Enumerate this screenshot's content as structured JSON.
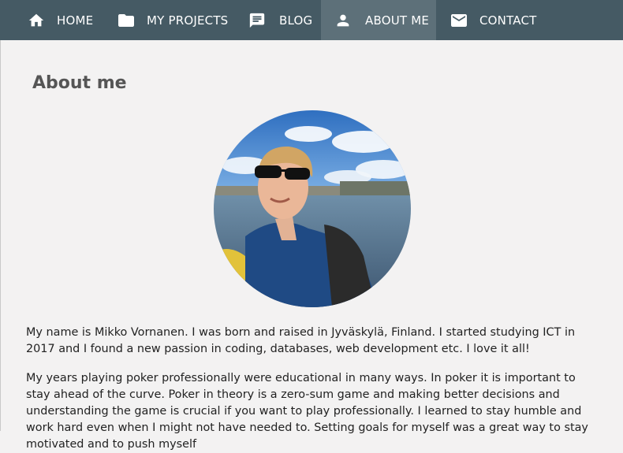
{
  "nav": {
    "items": [
      {
        "label": "HOME",
        "icon": "home-icon",
        "active": false
      },
      {
        "label": "MY PROJECTS",
        "icon": "folder-icon",
        "active": false
      },
      {
        "label": "BLOG",
        "icon": "comment-icon",
        "active": false
      },
      {
        "label": "ABOUT ME",
        "icon": "person-icon",
        "active": true
      },
      {
        "label": "CONTACT",
        "icon": "mail-icon",
        "active": false
      }
    ],
    "background": "#455a64",
    "active_background": "#5d7079"
  },
  "main": {
    "title": "About me",
    "paragraphs": [
      "My name is Mikko Vornanen. I was born and raised in Jyväskylä, Finland. I started studying ICT in 2017 and I found a new passion in coding, databases, web development etc. I love it all!",
      "My years playing poker professionally were educational in many ways. In poker it is important to stay ahead of the curve. Poker in theory is a zero-sum game and making better decisions and understanding the game is crucial if you want to play professionally. I learned to stay humble and work hard even when I might not have needed to. Setting goals for myself was a great way to stay motivated and to push myself"
    ],
    "background": "#f3f2f2"
  }
}
